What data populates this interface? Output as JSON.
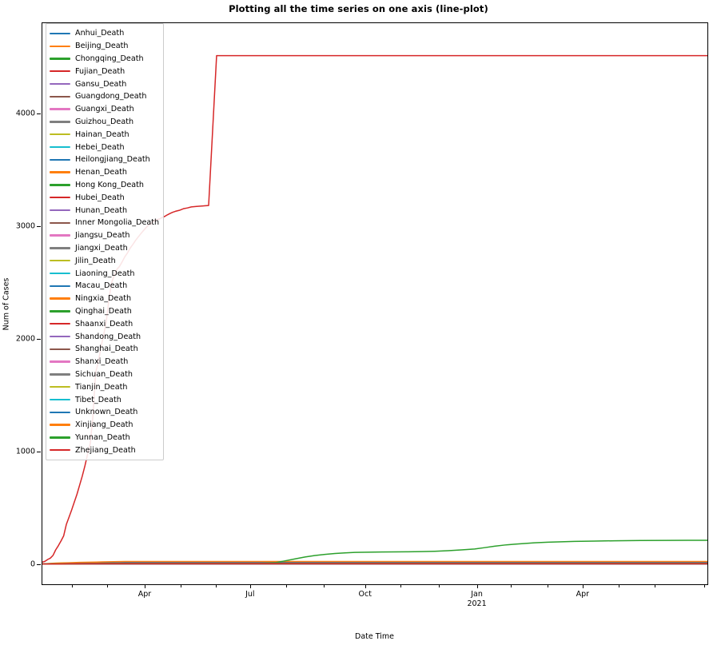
{
  "chart_data": {
    "type": "line",
    "title": "Plotting all the time series on one axis (line-plot)",
    "xlabel": "Date Time",
    "ylabel": "Num of Cases",
    "grid": false,
    "legend_position": "upper left",
    "ylim": [
      -180,
      4800
    ],
    "yticks": [
      0,
      1000,
      2000,
      3000,
      4000
    ],
    "ytick_labels": [
      "0",
      "1000",
      "2000",
      "3000",
      "4000"
    ],
    "xlim": [
      "2020-01-22",
      "2021-06-20"
    ],
    "xtick_labels": [
      {
        "label": "Apr",
        "sub": "",
        "pos": 0.155
      },
      {
        "label": "Jul",
        "sub": "",
        "pos": 0.3135
      },
      {
        "label": "Oct",
        "pos": 0.4865,
        "sub": ""
      },
      {
        "label": "Jan",
        "sub": "2021",
        "pos": 0.6545
      },
      {
        "label": "Apr",
        "sub": "",
        "pos": 0.8135
      }
    ],
    "xminor_ticks": [
      0.046,
      0.099,
      0.209,
      0.262,
      0.368,
      0.424,
      0.54,
      0.597,
      0.706,
      0.761,
      0.868,
      0.922,
      0.996
    ],
    "series": [
      {
        "name": "Anhui_Death",
        "color": "#1f77b4",
        "plateau": 6,
        "shape": "flat"
      },
      {
        "name": "Beijing_Death",
        "color": "#ff7f0e",
        "plateau": 9,
        "shape": "flat"
      },
      {
        "name": "Chongqing_Death",
        "color": "#2ca02c",
        "plateau": 6,
        "shape": "flat"
      },
      {
        "name": "Fujian_Death",
        "color": "#d62728",
        "plateau": 1,
        "shape": "flat"
      },
      {
        "name": "Gansu_Death",
        "color": "#9467bd",
        "plateau": 2,
        "shape": "flat"
      },
      {
        "name": "Guangdong_Death",
        "color": "#8c564b",
        "plateau": 8,
        "shape": "flat"
      },
      {
        "name": "Guangxi_Death",
        "color": "#e377c2",
        "plateau": 2,
        "shape": "flat"
      },
      {
        "name": "Guizhou_Death",
        "color": "#7f7f7f",
        "plateau": 2,
        "shape": "flat"
      },
      {
        "name": "Hainan_Death",
        "color": "#bcbd22",
        "plateau": 6,
        "shape": "flat"
      },
      {
        "name": "Hebei_Death",
        "color": "#17becf",
        "plateau": 7,
        "shape": "flat"
      },
      {
        "name": "Heilongjiang_Death",
        "color": "#1f77b4",
        "plateau": 13,
        "shape": "flat"
      },
      {
        "name": "Henan_Death",
        "color": "#ff7f0e",
        "plateau": 22,
        "shape": "flat"
      },
      {
        "name": "Hong Kong_Death",
        "color": "#2ca02c",
        "plateau": 210,
        "shape": "hongkong"
      },
      {
        "name": "Hubei_Death",
        "color": "#d62728",
        "plateau": 4512,
        "shape": "hubei"
      },
      {
        "name": "Hunan_Death",
        "color": "#9467bd",
        "plateau": 4,
        "shape": "flat"
      },
      {
        "name": "Inner Mongolia_Death",
        "color": "#8c564b",
        "plateau": 1,
        "shape": "flat"
      },
      {
        "name": "Jiangsu_Death",
        "color": "#e377c2",
        "plateau": 0,
        "shape": "flat"
      },
      {
        "name": "Jiangxi_Death",
        "color": "#7f7f7f",
        "plateau": 1,
        "shape": "flat"
      },
      {
        "name": "Jilin_Death",
        "color": "#bcbd22",
        "plateau": 3,
        "shape": "flat"
      },
      {
        "name": "Liaoning_Death",
        "color": "#17becf",
        "plateau": 2,
        "shape": "flat"
      },
      {
        "name": "Macau_Death",
        "color": "#1f77b4",
        "plateau": 0,
        "shape": "flat"
      },
      {
        "name": "Ningxia_Death",
        "color": "#ff7f0e",
        "plateau": 0,
        "shape": "flat"
      },
      {
        "name": "Qinghai_Death",
        "color": "#2ca02c",
        "plateau": 0,
        "shape": "flat"
      },
      {
        "name": "Shaanxi_Death",
        "color": "#d62728",
        "plateau": 3,
        "shape": "flat"
      },
      {
        "name": "Shandong_Death",
        "color": "#9467bd",
        "plateau": 7,
        "shape": "flat"
      },
      {
        "name": "Shanghai_Death",
        "color": "#8c564b",
        "plateau": 7,
        "shape": "flat"
      },
      {
        "name": "Shanxi_Death",
        "color": "#e377c2",
        "plateau": 0,
        "shape": "flat"
      },
      {
        "name": "Sichuan_Death",
        "color": "#7f7f7f",
        "plateau": 3,
        "shape": "flat"
      },
      {
        "name": "Tianjin_Death",
        "color": "#bcbd22",
        "plateau": 3,
        "shape": "flat"
      },
      {
        "name": "Tibet_Death",
        "color": "#17becf",
        "plateau": 0,
        "shape": "flat"
      },
      {
        "name": "Unknown_Death",
        "color": "#1f77b4",
        "plateau": 0,
        "shape": "flat"
      },
      {
        "name": "Xinjiang_Death",
        "color": "#ff7f0e",
        "plateau": 3,
        "shape": "flat"
      },
      {
        "name": "Yunnan_Death",
        "color": "#2ca02c",
        "plateau": 2,
        "shape": "flat"
      },
      {
        "name": "Zhejiang_Death",
        "color": "#d62728",
        "plateau": 1,
        "shape": "flat"
      }
    ],
    "hubei_points": [
      [
        0.0,
        17
      ],
      [
        0.004,
        24
      ],
      [
        0.008,
        40
      ],
      [
        0.012,
        52
      ],
      [
        0.016,
        76
      ],
      [
        0.02,
        125
      ],
      [
        0.024,
        162
      ],
      [
        0.028,
        204
      ],
      [
        0.032,
        249
      ],
      [
        0.036,
        350
      ],
      [
        0.04,
        414
      ],
      [
        0.044,
        479
      ],
      [
        0.048,
        549
      ],
      [
        0.052,
        618
      ],
      [
        0.056,
        699
      ],
      [
        0.06,
        780
      ],
      [
        0.064,
        871
      ],
      [
        0.068,
        974
      ],
      [
        0.072,
        1068
      ],
      [
        0.076,
        1310
      ],
      [
        0.08,
        1696
      ],
      [
        0.084,
        1789
      ],
      [
        0.088,
        1921
      ],
      [
        0.092,
        2029
      ],
      [
        0.096,
        2144
      ],
      [
        0.1,
        2346
      ],
      [
        0.104,
        2495
      ],
      [
        0.108,
        2563
      ],
      [
        0.112,
        2615
      ],
      [
        0.116,
        2641
      ],
      [
        0.12,
        2682
      ],
      [
        0.124,
        2727
      ],
      [
        0.128,
        2761
      ],
      [
        0.132,
        2803
      ],
      [
        0.136,
        2835
      ],
      [
        0.14,
        2871
      ],
      [
        0.144,
        2902
      ],
      [
        0.148,
        2931
      ],
      [
        0.152,
        2959
      ],
      [
        0.156,
        2986
      ],
      [
        0.16,
        3008
      ],
      [
        0.164,
        3024
      ],
      [
        0.168,
        3046
      ],
      [
        0.172,
        3056
      ],
      [
        0.176,
        3062
      ],
      [
        0.18,
        3075
      ],
      [
        0.184,
        3085
      ],
      [
        0.188,
        3099
      ],
      [
        0.192,
        3111
      ],
      [
        0.196,
        3122
      ],
      [
        0.2,
        3130
      ],
      [
        0.206,
        3139
      ],
      [
        0.212,
        3153
      ],
      [
        0.218,
        3160
      ],
      [
        0.224,
        3169
      ],
      [
        0.232,
        3174
      ],
      [
        0.24,
        3177
      ],
      [
        0.25,
        3182
      ],
      [
        0.262,
        4512
      ],
      [
        0.3,
        4512
      ],
      [
        0.4,
        4512
      ],
      [
        0.5,
        4512
      ],
      [
        0.6,
        4512
      ],
      [
        0.7,
        4512
      ],
      [
        0.8,
        4512
      ],
      [
        0.9,
        4512
      ],
      [
        1.0,
        4512
      ]
    ],
    "hongkong_points": [
      [
        0.0,
        0
      ],
      [
        0.06,
        0
      ],
      [
        0.12,
        1
      ],
      [
        0.18,
        4
      ],
      [
        0.24,
        4
      ],
      [
        0.3,
        5
      ],
      [
        0.33,
        7
      ],
      [
        0.35,
        12
      ],
      [
        0.365,
        28
      ],
      [
        0.38,
        45
      ],
      [
        0.395,
        62
      ],
      [
        0.41,
        75
      ],
      [
        0.425,
        85
      ],
      [
        0.44,
        93
      ],
      [
        0.455,
        98
      ],
      [
        0.47,
        103
      ],
      [
        0.49,
        105
      ],
      [
        0.51,
        106
      ],
      [
        0.53,
        107
      ],
      [
        0.55,
        108
      ],
      [
        0.57,
        110
      ],
      [
        0.59,
        113
      ],
      [
        0.61,
        118
      ],
      [
        0.63,
        125
      ],
      [
        0.65,
        133
      ],
      [
        0.665,
        145
      ],
      [
        0.68,
        158
      ],
      [
        0.695,
        168
      ],
      [
        0.71,
        176
      ],
      [
        0.725,
        182
      ],
      [
        0.74,
        188
      ],
      [
        0.76,
        193
      ],
      [
        0.78,
        197
      ],
      [
        0.8,
        200
      ],
      [
        0.83,
        203
      ],
      [
        0.86,
        206
      ],
      [
        0.9,
        208
      ],
      [
        0.94,
        209
      ],
      [
        0.97,
        210
      ],
      [
        1.0,
        210
      ]
    ]
  }
}
